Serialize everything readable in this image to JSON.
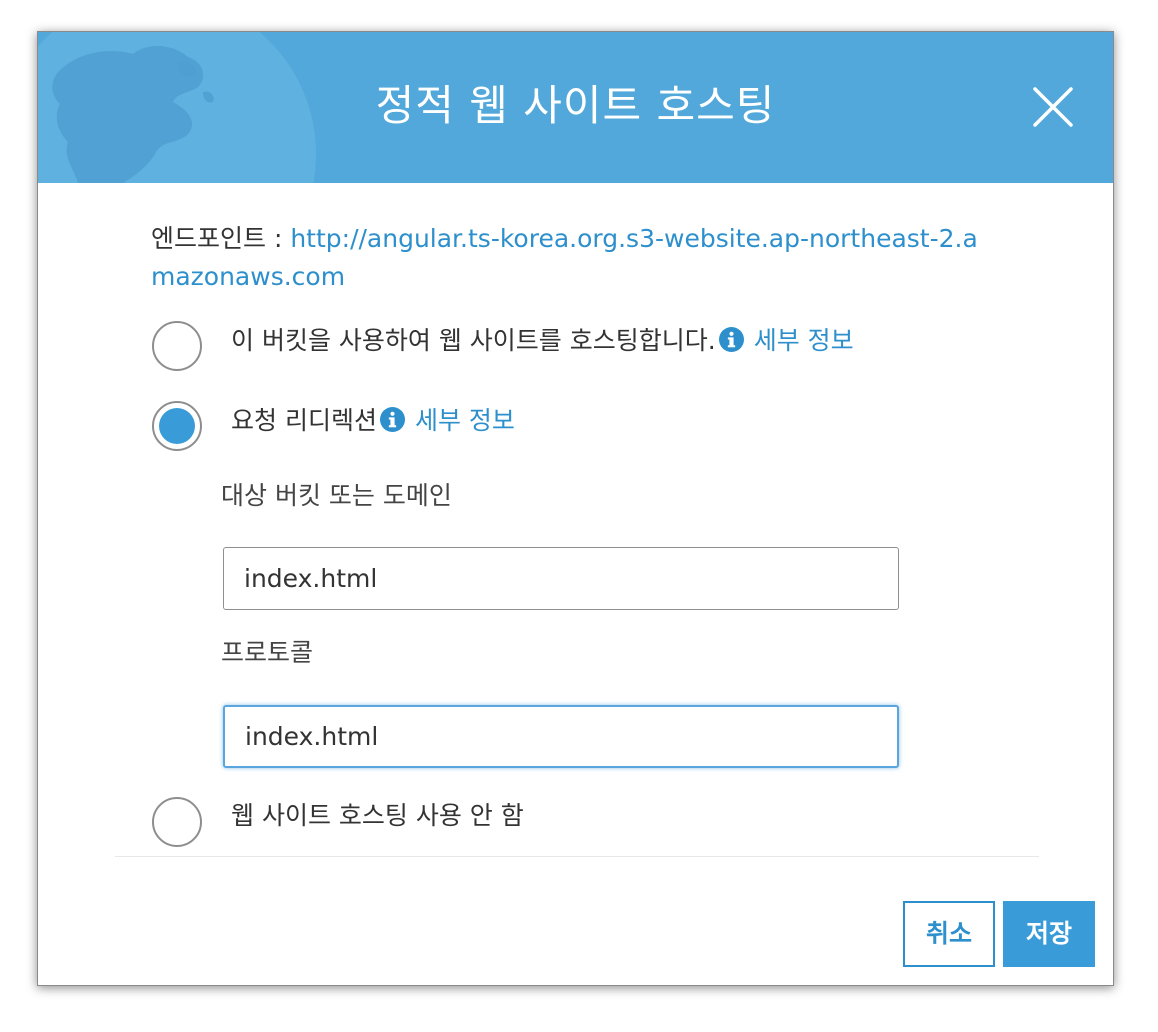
{
  "dialog": {
    "title": "정적 웹 사이트 호스팅",
    "close_icon": "close-icon"
  },
  "endpoint": {
    "label": "엔드포인트 : ",
    "url": "http://angular.ts-korea.org.s3-website.ap-northeast-2.amazonaws.com"
  },
  "options": [
    {
      "label": "이 버킷을 사용하여 웹 사이트를 호스팅합니다.",
      "more": "세부 정보",
      "selected": false
    },
    {
      "label": "요청 리디렉션",
      "more": "세부 정보",
      "selected": true
    },
    {
      "label": "웹 사이트 호스팅 사용 안 함",
      "selected": false
    }
  ],
  "redirect": {
    "target_label": "대상 버킷 또는 도메인",
    "target_value": "index.html",
    "protocol_label": "프로토콜",
    "protocol_value": "index.html"
  },
  "buttons": {
    "cancel": "취소",
    "save": "저장"
  },
  "colors": {
    "header": "#52a8da",
    "accent": "#3a9bd9",
    "link": "#2d8fcc"
  }
}
